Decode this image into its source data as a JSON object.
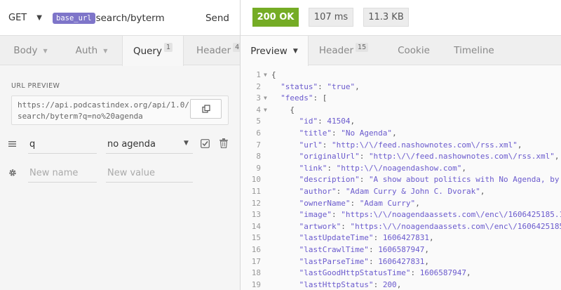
{
  "request": {
    "method": "GET",
    "base_url_tag": "base_url",
    "url_path": "search/byterm",
    "send_label": "Send"
  },
  "request_tabs": [
    {
      "label": "Body"
    },
    {
      "label": "Auth"
    },
    {
      "label": "Query",
      "badge": "1"
    },
    {
      "label": "Header",
      "badge": "4"
    }
  ],
  "url_preview": {
    "label": "URL PREVIEW",
    "value": "https://api.podcastindex.org/api/1.0/search/byterm?q=no%20agenda"
  },
  "params": [
    {
      "name": "q",
      "value": "no agenda"
    }
  ],
  "new_param": {
    "name_placeholder": "New name",
    "value_placeholder": "New value"
  },
  "response": {
    "status": "200 OK",
    "time": "107 ms",
    "size": "11.3 KB"
  },
  "response_tabs": [
    {
      "label": "Preview"
    },
    {
      "label": "Header",
      "badge": "15"
    },
    {
      "label": "Cookie"
    },
    {
      "label": "Timeline"
    }
  ],
  "code_lines": [
    {
      "n": "1",
      "fold": true,
      "indent": 0,
      "parts": [
        {
          "t": "p",
          "v": "{"
        }
      ]
    },
    {
      "n": "2",
      "fold": false,
      "indent": 1,
      "parts": [
        {
          "t": "k",
          "v": "\"status\""
        },
        {
          "t": "p",
          "v": ": "
        },
        {
          "t": "s",
          "v": "\"true\""
        },
        {
          "t": "p",
          "v": ","
        }
      ]
    },
    {
      "n": "3",
      "fold": true,
      "indent": 1,
      "parts": [
        {
          "t": "k",
          "v": "\"feeds\""
        },
        {
          "t": "p",
          "v": ": ["
        }
      ]
    },
    {
      "n": "4",
      "fold": true,
      "indent": 2,
      "parts": [
        {
          "t": "p",
          "v": "{"
        }
      ]
    },
    {
      "n": "5",
      "fold": false,
      "indent": 3,
      "parts": [
        {
          "t": "k",
          "v": "\"id\""
        },
        {
          "t": "p",
          "v": ": "
        },
        {
          "t": "n",
          "v": "41504"
        },
        {
          "t": "p",
          "v": ","
        }
      ]
    },
    {
      "n": "6",
      "fold": false,
      "indent": 3,
      "parts": [
        {
          "t": "k",
          "v": "\"title\""
        },
        {
          "t": "p",
          "v": ": "
        },
        {
          "t": "s",
          "v": "\"No Agenda\""
        },
        {
          "t": "p",
          "v": ","
        }
      ]
    },
    {
      "n": "7",
      "fold": false,
      "indent": 3,
      "parts": [
        {
          "t": "k",
          "v": "\"url\""
        },
        {
          "t": "p",
          "v": ": "
        },
        {
          "t": "s",
          "v": "\"http:\\/\\/feed.nashownotes.com\\/rss.xml\""
        },
        {
          "t": "p",
          "v": ","
        }
      ]
    },
    {
      "n": "8",
      "fold": false,
      "indent": 3,
      "parts": [
        {
          "t": "k",
          "v": "\"originalUrl\""
        },
        {
          "t": "p",
          "v": ": "
        },
        {
          "t": "s",
          "v": "\"http:\\/\\/feed.nashownotes.com\\/rss.xml\""
        },
        {
          "t": "p",
          "v": ","
        }
      ]
    },
    {
      "n": "9",
      "fold": false,
      "indent": 3,
      "parts": [
        {
          "t": "k",
          "v": "\"link\""
        },
        {
          "t": "p",
          "v": ": "
        },
        {
          "t": "s",
          "v": "\"http:\\/\\/noagendashow.com\""
        },
        {
          "t": "p",
          "v": ","
        }
      ]
    },
    {
      "n": "10",
      "fold": false,
      "indent": 3,
      "parts": [
        {
          "t": "k",
          "v": "\"description\""
        },
        {
          "t": "p",
          "v": ": "
        },
        {
          "t": "s",
          "v": "\"A show about politics with No Agenda, by"
        }
      ]
    },
    {
      "n": "11",
      "fold": false,
      "indent": 3,
      "parts": [
        {
          "t": "k",
          "v": "\"author\""
        },
        {
          "t": "p",
          "v": ": "
        },
        {
          "t": "s",
          "v": "\"Adam Curry & John C. Dvorak\""
        },
        {
          "t": "p",
          "v": ","
        }
      ]
    },
    {
      "n": "12",
      "fold": false,
      "indent": 3,
      "parts": [
        {
          "t": "k",
          "v": "\"ownerName\""
        },
        {
          "t": "p",
          "v": ": "
        },
        {
          "t": "s",
          "v": "\"Adam Curry\""
        },
        {
          "t": "p",
          "v": ","
        }
      ]
    },
    {
      "n": "13",
      "fold": false,
      "indent": 3,
      "parts": [
        {
          "t": "k",
          "v": "\"image\""
        },
        {
          "t": "p",
          "v": ": "
        },
        {
          "t": "s",
          "v": "\"https:\\/\\/noagendaassets.com\\/enc\\/1606425185.1"
        }
      ]
    },
    {
      "n": "14",
      "fold": false,
      "indent": 3,
      "parts": [
        {
          "t": "k",
          "v": "\"artwork\""
        },
        {
          "t": "p",
          "v": ": "
        },
        {
          "t": "s",
          "v": "\"https:\\/\\/noagendaassets.com\\/enc\\/1606425185"
        }
      ]
    },
    {
      "n": "15",
      "fold": false,
      "indent": 3,
      "parts": [
        {
          "t": "k",
          "v": "\"lastUpdateTime\""
        },
        {
          "t": "p",
          "v": ": "
        },
        {
          "t": "n",
          "v": "1606427831"
        },
        {
          "t": "p",
          "v": ","
        }
      ]
    },
    {
      "n": "16",
      "fold": false,
      "indent": 3,
      "parts": [
        {
          "t": "k",
          "v": "\"lastCrawlTime\""
        },
        {
          "t": "p",
          "v": ": "
        },
        {
          "t": "n",
          "v": "1606587947"
        },
        {
          "t": "p",
          "v": ","
        }
      ]
    },
    {
      "n": "17",
      "fold": false,
      "indent": 3,
      "parts": [
        {
          "t": "k",
          "v": "\"lastParseTime\""
        },
        {
          "t": "p",
          "v": ": "
        },
        {
          "t": "n",
          "v": "1606427831"
        },
        {
          "t": "p",
          "v": ","
        }
      ]
    },
    {
      "n": "18",
      "fold": false,
      "indent": 3,
      "parts": [
        {
          "t": "k",
          "v": "\"lastGoodHttpStatusTime\""
        },
        {
          "t": "p",
          "v": ": "
        },
        {
          "t": "n",
          "v": "1606587947"
        },
        {
          "t": "p",
          "v": ","
        }
      ]
    },
    {
      "n": "19",
      "fold": false,
      "indent": 3,
      "parts": [
        {
          "t": "k",
          "v": "\"lastHttpStatus\""
        },
        {
          "t": "p",
          "v": ": "
        },
        {
          "t": "n",
          "v": "200"
        },
        {
          "t": "p",
          "v": ","
        }
      ]
    }
  ],
  "colors": {
    "status_ok": "#75ac25",
    "base_url_tag": "#7e75c9",
    "json_token": "#6a5acd"
  }
}
